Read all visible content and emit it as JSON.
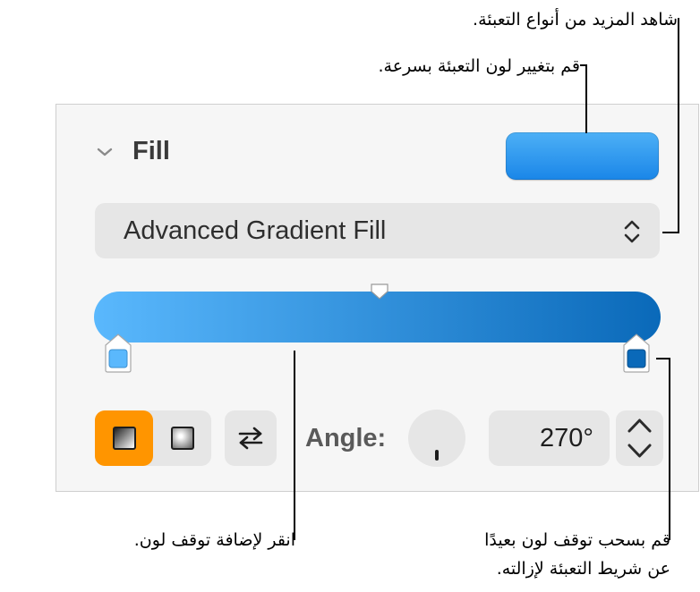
{
  "callouts": {
    "more_fill_types": "شاهد المزيد من أنواع التعبئة.",
    "quick_fill_color": "قم بتغيير لون التعبئة بسرعة.",
    "add_color_stop": "انقر لإضافة توقف لون.",
    "remove_color_stop_line1": "قم بسحب توقف لون بعيدًا",
    "remove_color_stop_line2": "عن شريط التعبئة لإزالته."
  },
  "fill_panel": {
    "section_title": "Fill",
    "fill_type_value": "Advanced Gradient Fill",
    "angle_label": "Angle:",
    "angle_value": "270°"
  },
  "colors": {
    "color_well": "#2196ee",
    "gradient_start": "#5ab8fd",
    "gradient_end": "#0a69b9",
    "stop_left": "#5ab8fd",
    "stop_right": "#0a69b9",
    "selected_segment": "#ff9500"
  },
  "icons": {
    "section_toggle": "chevron-down-icon",
    "popup_arrows": "up-down-chevron-icon",
    "linear_gradient": "linear-gradient-square-icon",
    "radial_gradient": "radial-gradient-square-icon",
    "swap": "swap-arrows-icon",
    "stepper_up": "chevron-up-icon",
    "stepper_down": "chevron-down-icon"
  }
}
